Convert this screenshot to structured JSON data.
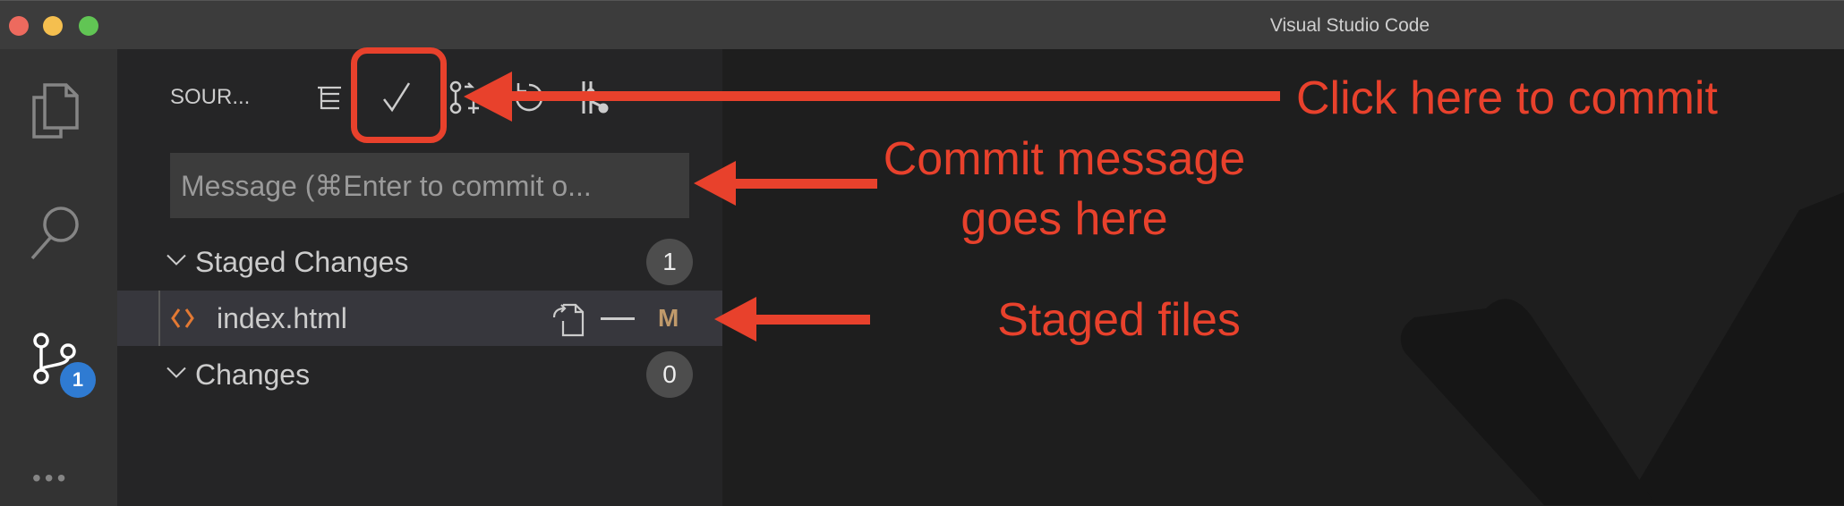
{
  "window": {
    "title": "Visual Studio Code"
  },
  "activity_bar": {
    "items": [
      {
        "name": "explorer",
        "icon": "files-icon"
      },
      {
        "name": "search",
        "icon": "search-icon"
      },
      {
        "name": "source-control",
        "icon": "source-control-icon",
        "badge": "1"
      },
      {
        "name": "more",
        "icon": "ellipsis-icon"
      }
    ]
  },
  "sidebar": {
    "title": "SOUR...",
    "toolbar": [
      "tree-view-icon",
      "commit-check-icon",
      "pull-request-icon",
      "refresh-icon",
      "more-actions-icon"
    ],
    "message_placeholder": "Message (⌘Enter to commit o...",
    "staged": {
      "label": "Staged Changes",
      "count": "1"
    },
    "files": [
      {
        "name": "index.html",
        "status": "M",
        "status_color": "#c09a6b"
      }
    ],
    "changes": {
      "label": "Changes",
      "count": "0"
    }
  },
  "annotations": {
    "commit": "Click here to commit",
    "message_line1": "Commit message",
    "message_line2": "goes here",
    "staged": "Staged files",
    "color": "#e8412c"
  }
}
